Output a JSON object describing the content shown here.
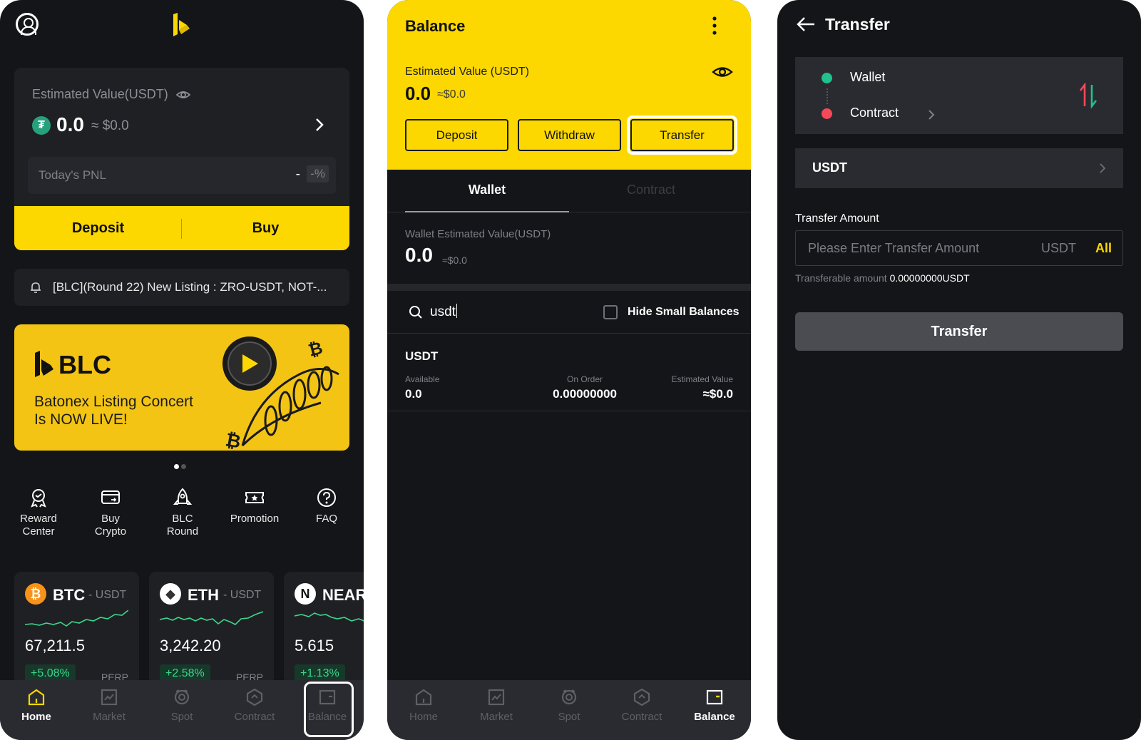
{
  "colors": {
    "accent": "#fcd800",
    "bg": "#141518",
    "card": "#1f2024",
    "positive": "#3dd68c",
    "negative": "#f34a5a"
  },
  "home": {
    "est_label": "Estimated Value(USDT)",
    "est_value": "0.0",
    "est_fiat": "≈ $0.0",
    "pnl_label": "Today's PNL",
    "pnl_value": "-",
    "pnl_pct": "-%",
    "deposit_label": "Deposit",
    "buy_label": "Buy",
    "notice": "[BLC](Round 22) New Listing : ZRO-USDT, NOT-...",
    "banner": {
      "brand": "BLC",
      "line1": "Batonex Listing Concert",
      "line2": "Is NOW LIVE!"
    },
    "quick_links": [
      {
        "label": "Reward\nCenter",
        "icon": "reward-icon"
      },
      {
        "label": "Buy\nCrypto",
        "icon": "card-icon"
      },
      {
        "label": "BLC\nRound",
        "icon": "rocket-icon"
      },
      {
        "label": "Promotion",
        "icon": "ticket-icon"
      },
      {
        "label": "FAQ",
        "icon": "help-icon"
      }
    ],
    "tickers": [
      {
        "symbol": "BTC",
        "quote": "- USDT",
        "price": "67,211.5",
        "change": "+5.08%",
        "type": "PERP"
      },
      {
        "symbol": "ETH",
        "quote": "- USDT",
        "price": "3,242.20",
        "change": "+2.58%",
        "type": "PERP"
      },
      {
        "symbol": "NEAR",
        "quote": "",
        "price": "5.615",
        "change": "+1.13%",
        "type": ""
      }
    ]
  },
  "nav": {
    "items": [
      {
        "label": "Home",
        "icon": "home-icon"
      },
      {
        "label": "Market",
        "icon": "chart-icon"
      },
      {
        "label": "Spot",
        "icon": "spot-icon"
      },
      {
        "label": "Contract",
        "icon": "contract-icon"
      },
      {
        "label": "Balance",
        "icon": "wallet-icon"
      }
    ]
  },
  "balance": {
    "title": "Balance",
    "est_label": "Estimated Value (USDT)",
    "est_value": "0.0",
    "est_fiat": "≈$0.0",
    "deposit_label": "Deposit",
    "withdraw_label": "Withdraw",
    "transfer_label": "Transfer",
    "tabs": [
      "Wallet",
      "Contract"
    ],
    "wallet_est_label": "Wallet Estimated Value(USDT)",
    "wallet_value": "0.0",
    "wallet_fiat": "≈$0.0",
    "search_value": "usdt",
    "hide_small_label": "Hide Small Balances",
    "asset": {
      "name": "USDT",
      "available_label": "Available",
      "available": "0.0",
      "on_order_label": "On Order",
      "on_order": "0.00000000",
      "estimated_label": "Estimated Value",
      "estimated": "≈$0.0"
    }
  },
  "transfer": {
    "title": "Transfer",
    "from": "Wallet",
    "to": "Contract",
    "coin": "USDT",
    "amount_label": "Transfer Amount",
    "amount_placeholder": "Please Enter Transfer Amount",
    "amount_unit": "USDT",
    "all_label": "All",
    "transferable_label": "Transferable amount",
    "transferable_value": "0.00000000USDT",
    "button_label": "Transfer"
  }
}
